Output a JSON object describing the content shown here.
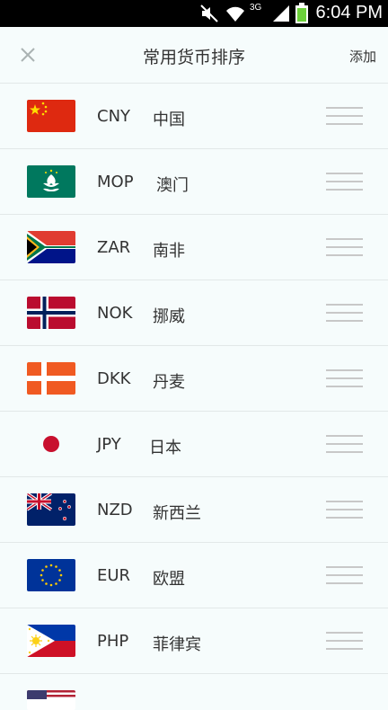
{
  "status_bar": {
    "time": "6:04 PM",
    "network": "3G"
  },
  "header": {
    "title": "常用货币排序",
    "add_label": "添加"
  },
  "currencies": [
    {
      "code": "CNY",
      "name": "中国",
      "flag": "china-flag-icon"
    },
    {
      "code": "MOP",
      "name": "澳门",
      "flag": "macau-flag-icon"
    },
    {
      "code": "ZAR",
      "name": "南非",
      "flag": "south-africa-flag-icon"
    },
    {
      "code": "NOK",
      "name": "挪威",
      "flag": "norway-flag-icon"
    },
    {
      "code": "DKK",
      "name": "丹麦",
      "flag": "denmark-flag-icon"
    },
    {
      "code": "JPY",
      "name": "日本",
      "flag": "japan-flag-icon"
    },
    {
      "code": "NZD",
      "name": "新西兰",
      "flag": "new-zealand-flag-icon"
    },
    {
      "code": "EUR",
      "name": "欧盟",
      "flag": "eu-flag-icon"
    },
    {
      "code": "PHP",
      "name": "菲律宾",
      "flag": "philippines-flag-icon"
    }
  ],
  "colors": {
    "background": "#f6fcfc",
    "divider": "#e2e8e8",
    "handle": "#c8c8c8",
    "text": "#333333"
  }
}
